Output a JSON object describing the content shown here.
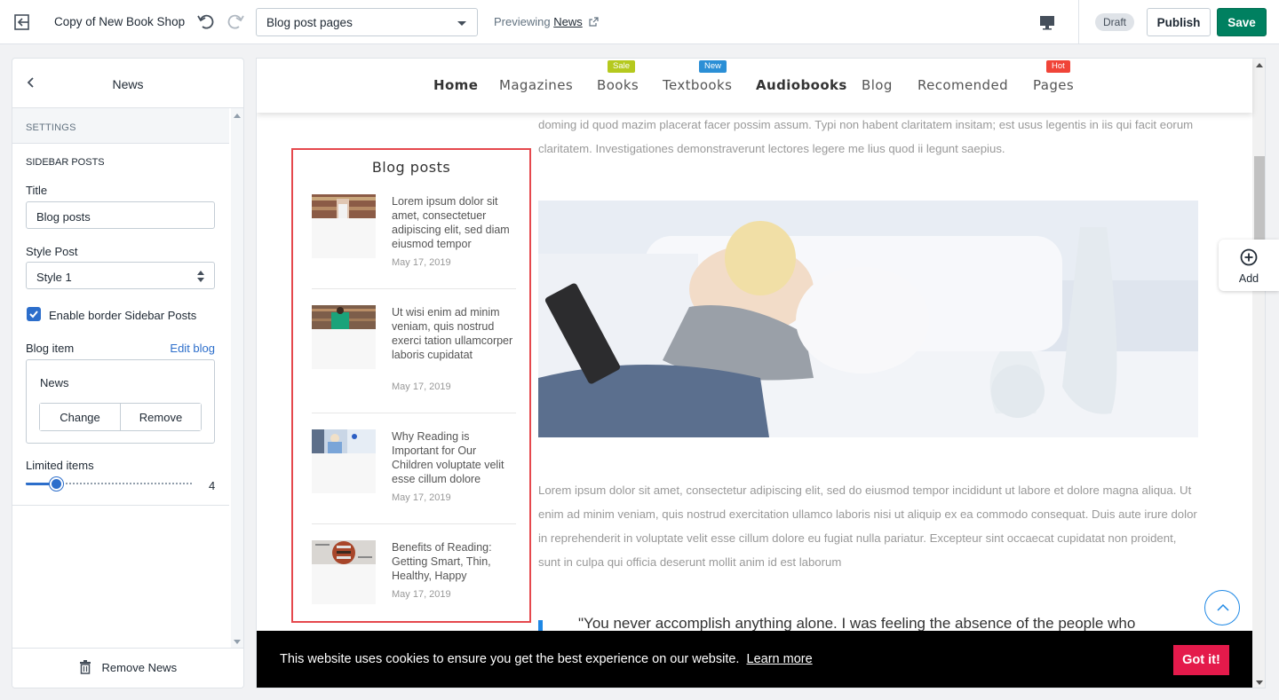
{
  "topbar": {
    "shop_name": "Copy of New Book Shop",
    "page_select": "Blog post pages",
    "previewing_label": "Previewing",
    "previewing_link": "News",
    "draft_badge": "Draft",
    "publish_label": "Publish",
    "save_label": "Save"
  },
  "panel": {
    "title": "News",
    "settings_label": "SETTINGS",
    "section_label": "SIDEBAR POSTS",
    "title_label": "Title",
    "title_value": "Blog posts",
    "style_label": "Style Post",
    "style_value": "Style 1",
    "border_checkbox_label": "Enable border Sidebar Posts",
    "border_checked": true,
    "blog_item_label": "Blog item",
    "edit_blog_link": "Edit blog",
    "blog_item_name": "News",
    "change_label": "Change",
    "remove_label": "Remove",
    "limited_label": "Limited items",
    "limited_value": "4",
    "remove_section_label": "Remove News"
  },
  "nav": {
    "items": [
      {
        "label": "Home",
        "bold": true
      },
      {
        "label": "Magazines"
      },
      {
        "label": "Books",
        "badge": "Sale",
        "badge_color": "#b5c91e"
      },
      {
        "label": "Textbooks",
        "badge": "New",
        "badge_color": "#2b8fd6"
      },
      {
        "label": "Audiobooks",
        "bold": true
      },
      {
        "label": "Blog"
      },
      {
        "label": "Recomended"
      },
      {
        "label": "Pages",
        "badge": "Hot",
        "badge_color": "#f04438"
      }
    ]
  },
  "sidebar_posts": {
    "title": "Blog posts",
    "items": [
      {
        "title": "Lorem ipsum dolor sit amet, consectetuer adipiscing elit, sed diam eiusmod tempor",
        "date": "May 17, 2019"
      },
      {
        "title": "Ut wisi enim ad minim veniam, quis nostrud exerci tation ullamcorper laboris cupidatat",
        "date": "May 17, 2019"
      },
      {
        "title": "Why Reading is Important for Our Children voluptate velit esse cillum dolore",
        "date": "May 17, 2019"
      },
      {
        "title": "Benefits of Reading: Getting Smart, Thin, Healthy, Happy",
        "date": "May 17, 2019"
      }
    ]
  },
  "article": {
    "intro": "doming id quod mazim placerat facer possim assum. Typi non habent claritatem insitam; est usus legentis in iis qui facit eorum claritatem. Investigationes demonstraverunt lectores legere me lius quod ii legunt saepius.",
    "body": "Lorem ipsum dolor sit amet, consectetur adipiscing elit, sed do eiusmod tempor incididunt ut labore et dolore magna aliqua. Ut enim ad minim veniam, quis nostrud exercitation ullamco laboris nisi ut aliquip ex ea commodo consequat. Duis aute irure dolor in reprehenderit in voluptate velit esse cillum dolore eu fugiat nulla pariatur. Excepteur sint occaecat cupidatat non proident, sunt in culpa qui officia deserunt mollit anim id est laborum",
    "quote": "\"You never accomplish anything alone. I was feeling the absence of the people who"
  },
  "cookie": {
    "text": "This website uses cookies to ensure you get the best experience on our website.",
    "link": "Learn more",
    "button": "Got it!"
  },
  "add_button": "Add"
}
